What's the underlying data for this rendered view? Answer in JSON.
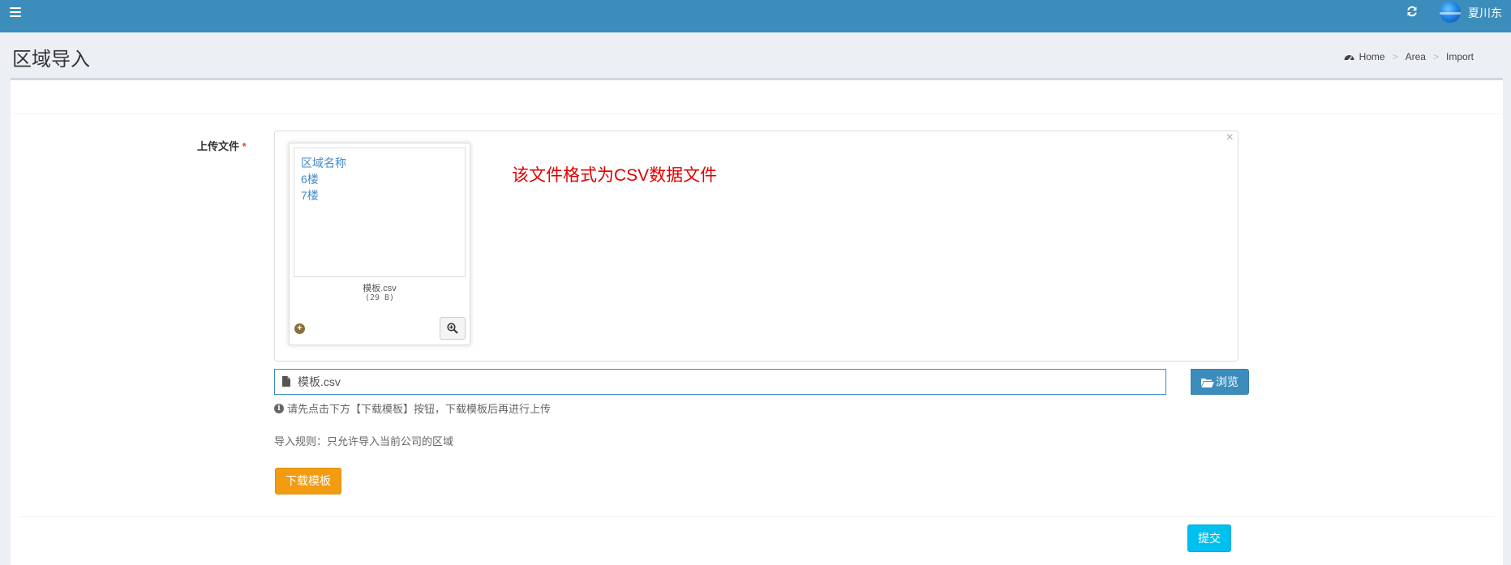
{
  "header": {
    "menu_icon": "hamburger-icon",
    "refresh_icon": "refresh-icon",
    "username": "夏川东"
  },
  "page": {
    "title": "区域导入"
  },
  "breadcrumb": {
    "icon": "dashboard-icon",
    "items": [
      "Home",
      "Area",
      "Import"
    ]
  },
  "form": {
    "upload_label": "上传文件",
    "required_mark": "*",
    "preview": {
      "close_glyph": "×",
      "lines": [
        "区域名称",
        "6楼",
        "7楼"
      ],
      "file_name": "模板.csv",
      "file_size": "(29 B)",
      "plus_glyph": "+",
      "zoom_icon": "zoom-in-icon"
    },
    "format_note": "该文件格式为CSV数据文件",
    "file_input_value": "模板.csv",
    "browse_label": "浏览",
    "info_glyph": "i",
    "help_text": "请先点击下方【下载模板】按钮，下载模板后再进行上传",
    "rule_text": "导入规则：只允许导入当前公司的区域",
    "download_label": "下载模板",
    "submit_label": "提交"
  },
  "colors": {
    "header_bg": "#3c8dbc",
    "primary": "#3c8dbc",
    "warning": "#f39c12",
    "info": "#00c0ef",
    "note_red": "#e00000",
    "required": "#dd4b39"
  }
}
